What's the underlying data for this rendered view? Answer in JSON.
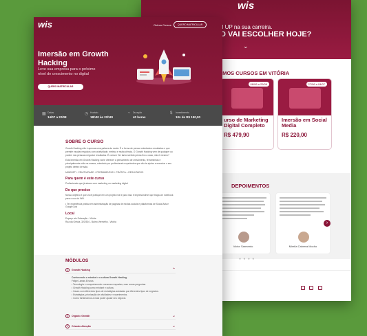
{
  "back": {
    "logo": "wis",
    "hero_tag": "UM UP na sua carreira.",
    "hero_big": "SO VAI ESCOLHER HOJE?",
    "section_title": "IMOS CURSOS EM VITÓRIA",
    "cards": [
      {
        "date": "06/06 a 29/06",
        "title": "urso de Marketing Digital Completo",
        "desc": "",
        "price": "R$ 479,90"
      },
      {
        "date": "27/06 a 04/07",
        "title": "Imersão em Social Media",
        "desc": "",
        "price": "R$ 220,00"
      }
    ],
    "dep_title": "DEPOIMENTOS",
    "testimonials": [
      {
        "name": "Victor Sarmento",
        "role": ""
      },
      {
        "name": "Mirella Cabrera Mocho",
        "role": ""
      }
    ]
  },
  "front": {
    "logo": "wis",
    "nav_link": "Outros Cursos",
    "nav_button": "QUERO MATRICULAR",
    "hero_title": "Imersão em Growth Hacking",
    "hero_subtitle": "Leve sua empresa para o próximo nível de crescimento no digital",
    "hero_button": "QUERO MATRICULAR",
    "stats": [
      {
        "icon": "calendar-icon",
        "label": "Datas",
        "value": "14/07 a 22/08"
      },
      {
        "icon": "clock-icon",
        "label": "Horário",
        "value": "18h30 às 22h30"
      },
      {
        "icon": "timer-icon",
        "label": "Duração",
        "value": "40 horas"
      },
      {
        "icon": "money-icon",
        "label": "Investimento",
        "value": "10x de R$ 190,00"
      }
    ],
    "about_title": "SOBRE O CURSO",
    "about_p1": "Growth Hacking não é apenas uma palavra da moda. É a forma de pensar orientada a resultados e que permite escalar negócios com criatividade, métrica e muita ciência. O Growth Hacking vem de qualquer ou podem nas pessoas negociar resultados. É comum Ver tanto sentido pensa fixo a caso, não é mesmo?",
    "about_p2": "Esta Imersão em Growth Hacking vai te oferecer a pensamento de crescimento, ferramentas e principalmente mão na massa, orientado por profissionais experientes que vão te ajudar a executar o seu projeto dentro de sala.",
    "about_p3": "MINDSET + CRIATIVIDADE + FERRAMENTAS + PRÁTICA = RESULTADOS",
    "for_title": "Para quem é este curso",
    "for_p": "Profissionais que já atuam com marketing ou marketing digital",
    "need_title": "Do que preciso",
    "need_p": "Nosso objetivo é que você pratique em um projeto real e para isso é imprescindível que traga um notebook para o uso do Wifi.",
    "need_p2": "• Ter experiência prática em administração de páginas de mídias sociais e plataformas de Social Ads e Google Ads",
    "local_title": "Local",
    "local_p": "Espaço wis Educação - Vitória",
    "local_p2": "Rua da Grécia, 320/304 - Bairro Vermelho - Vitória",
    "modules_title": "MÓDULOS",
    "modules": [
      {
        "num": "1",
        "name": "Growth Hacking"
      },
      {
        "num": "2",
        "name": "Organic Growth"
      },
      {
        "num": "3",
        "name": "Criando Atenção"
      }
    ],
    "module1_lines": [
      "Conhecendo o mindset e a cultura Growth Hacking.",
      "Felipe Lamas   8 horas",
      "• Tecnologia e comportamento: mesmas respostas, mas novas perguntas.",
      "• Growth Hacking como mindset e cultura.",
      "• Cases com diferentes tipos de estratégias adotadas por diferentes tipos de negócios.",
      "• Estratégias, priorização de atividades e experimentos.",
      "• Como fortalecimos a mais poder ajudar seu negócio."
    ]
  }
}
